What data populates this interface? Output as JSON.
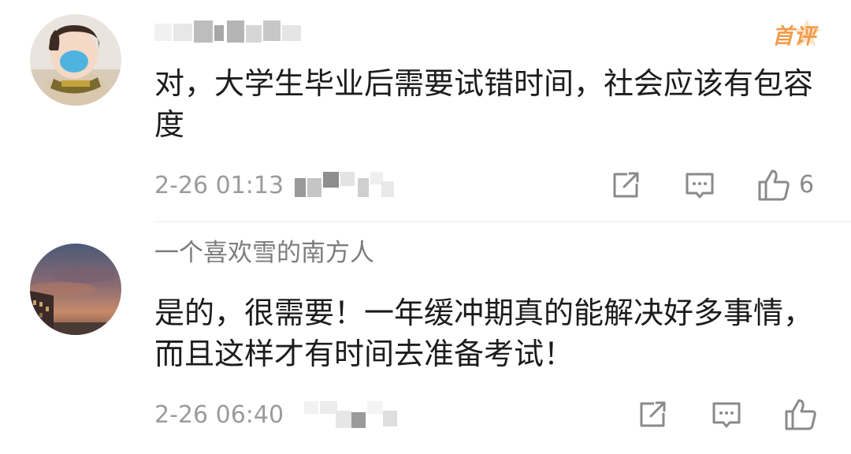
{
  "comments": [
    {
      "username": "",
      "badge": "首评",
      "text": "对，大学生毕业后需要试错时间，社会应该有包容度",
      "timestamp": "2-26 01:13",
      "likes": "6",
      "actions": [
        "share-icon",
        "reply-icon",
        "like-icon"
      ]
    },
    {
      "username": "一个喜欢雪的南方人",
      "text": "是的，很需要！一年缓冲期真的能解决好多事情，而且这样才有时间去准备考试！",
      "timestamp": "2-26 06:40",
      "likes": "",
      "actions": [
        "share-icon",
        "reply-icon",
        "like-icon"
      ]
    }
  ],
  "colors": {
    "text": "#1c1c1c",
    "username": "#7c7c7c",
    "meta": "#9b9b9b",
    "badge": "#f29c4a",
    "icon": "#8a8a8a"
  }
}
